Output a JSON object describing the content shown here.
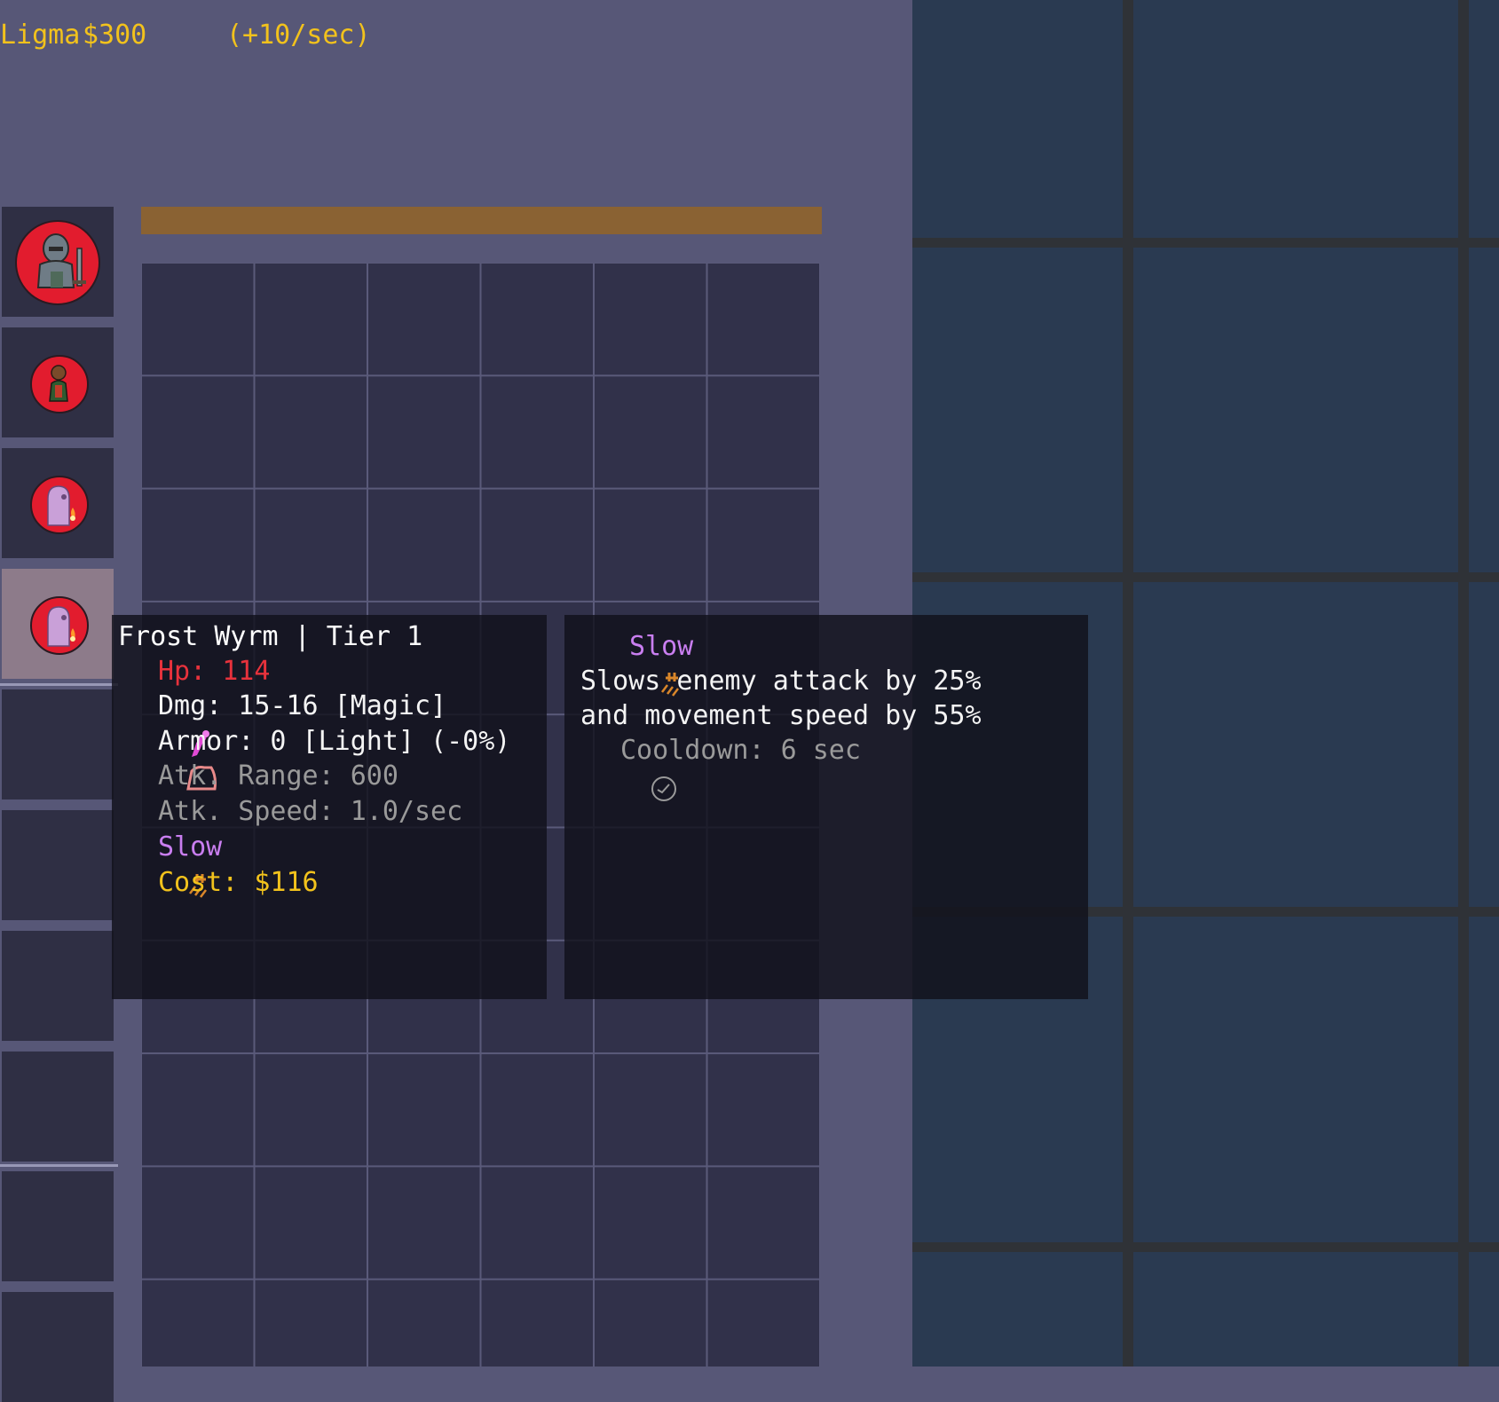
{
  "hud": {
    "player": "Ligma",
    "money": "$300",
    "income": "(+10/sec)"
  },
  "sidebar": {
    "units": [
      {
        "slot": 1,
        "portrait": "armored-knight-icon"
      },
      {
        "slot": 2,
        "portrait": "ranger-icon"
      },
      {
        "slot": 3,
        "portrait": "frost-wyrm-icon"
      },
      {
        "slot": 4,
        "portrait": "frost-wyrm-icon",
        "selected": true
      }
    ],
    "empty_slots": 6
  },
  "tooltip_unit": {
    "title": "Frost Wyrm | Tier 1",
    "hp": "Hp: 114",
    "damage": "Dmg: 15-16 [Magic]",
    "armor": "Armor: 0 [Light] (-0%)",
    "range": "Atk. Range: 600",
    "speed": "Atk. Speed: 1.0/sec",
    "ability": "Slow",
    "cost": "Cost: $116"
  },
  "tooltip_ability": {
    "name": "Slow",
    "desc_line1": "Slows enemy attack by 25%",
    "desc_line2": "and movement speed by 55%",
    "cooldown": "Cooldown: 6 sec"
  },
  "colors": {
    "panel_bg": "#575777",
    "game_bg": "#2a3a51",
    "gold": "#f2c21c",
    "hp_red": "#e8323c",
    "ability_purple": "#c97ef0",
    "muted_gray": "#9a9a9a",
    "progress_bar": "#8a6233"
  }
}
